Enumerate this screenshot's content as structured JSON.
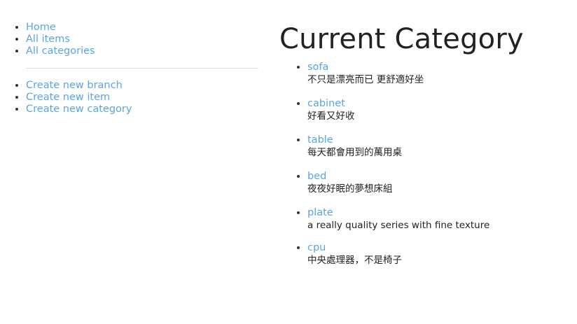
{
  "sidebar": {
    "nav": [
      {
        "label": "Home"
      },
      {
        "label": "All items"
      },
      {
        "label": "All categories"
      }
    ],
    "actions": [
      {
        "label": "Create new branch"
      },
      {
        "label": "Create new item"
      },
      {
        "label": "Create new category"
      }
    ]
  },
  "main": {
    "title": "Current Category",
    "categories": [
      {
        "name": "sofa",
        "description": "不只是漂亮而已 更舒適好坐"
      },
      {
        "name": "cabinet",
        "description": "好看又好收"
      },
      {
        "name": "table",
        "description": "每天都會用到的萬用桌"
      },
      {
        "name": "bed",
        "description": "夜夜好眠的夢想床組"
      },
      {
        "name": "plate",
        "description": "a really quality series with fine texture"
      },
      {
        "name": "cpu",
        "description": "中央處理器，不是椅子"
      }
    ]
  },
  "colors": {
    "link": "#5aa5e6",
    "text": "#222222",
    "divider": "#dddddd"
  }
}
